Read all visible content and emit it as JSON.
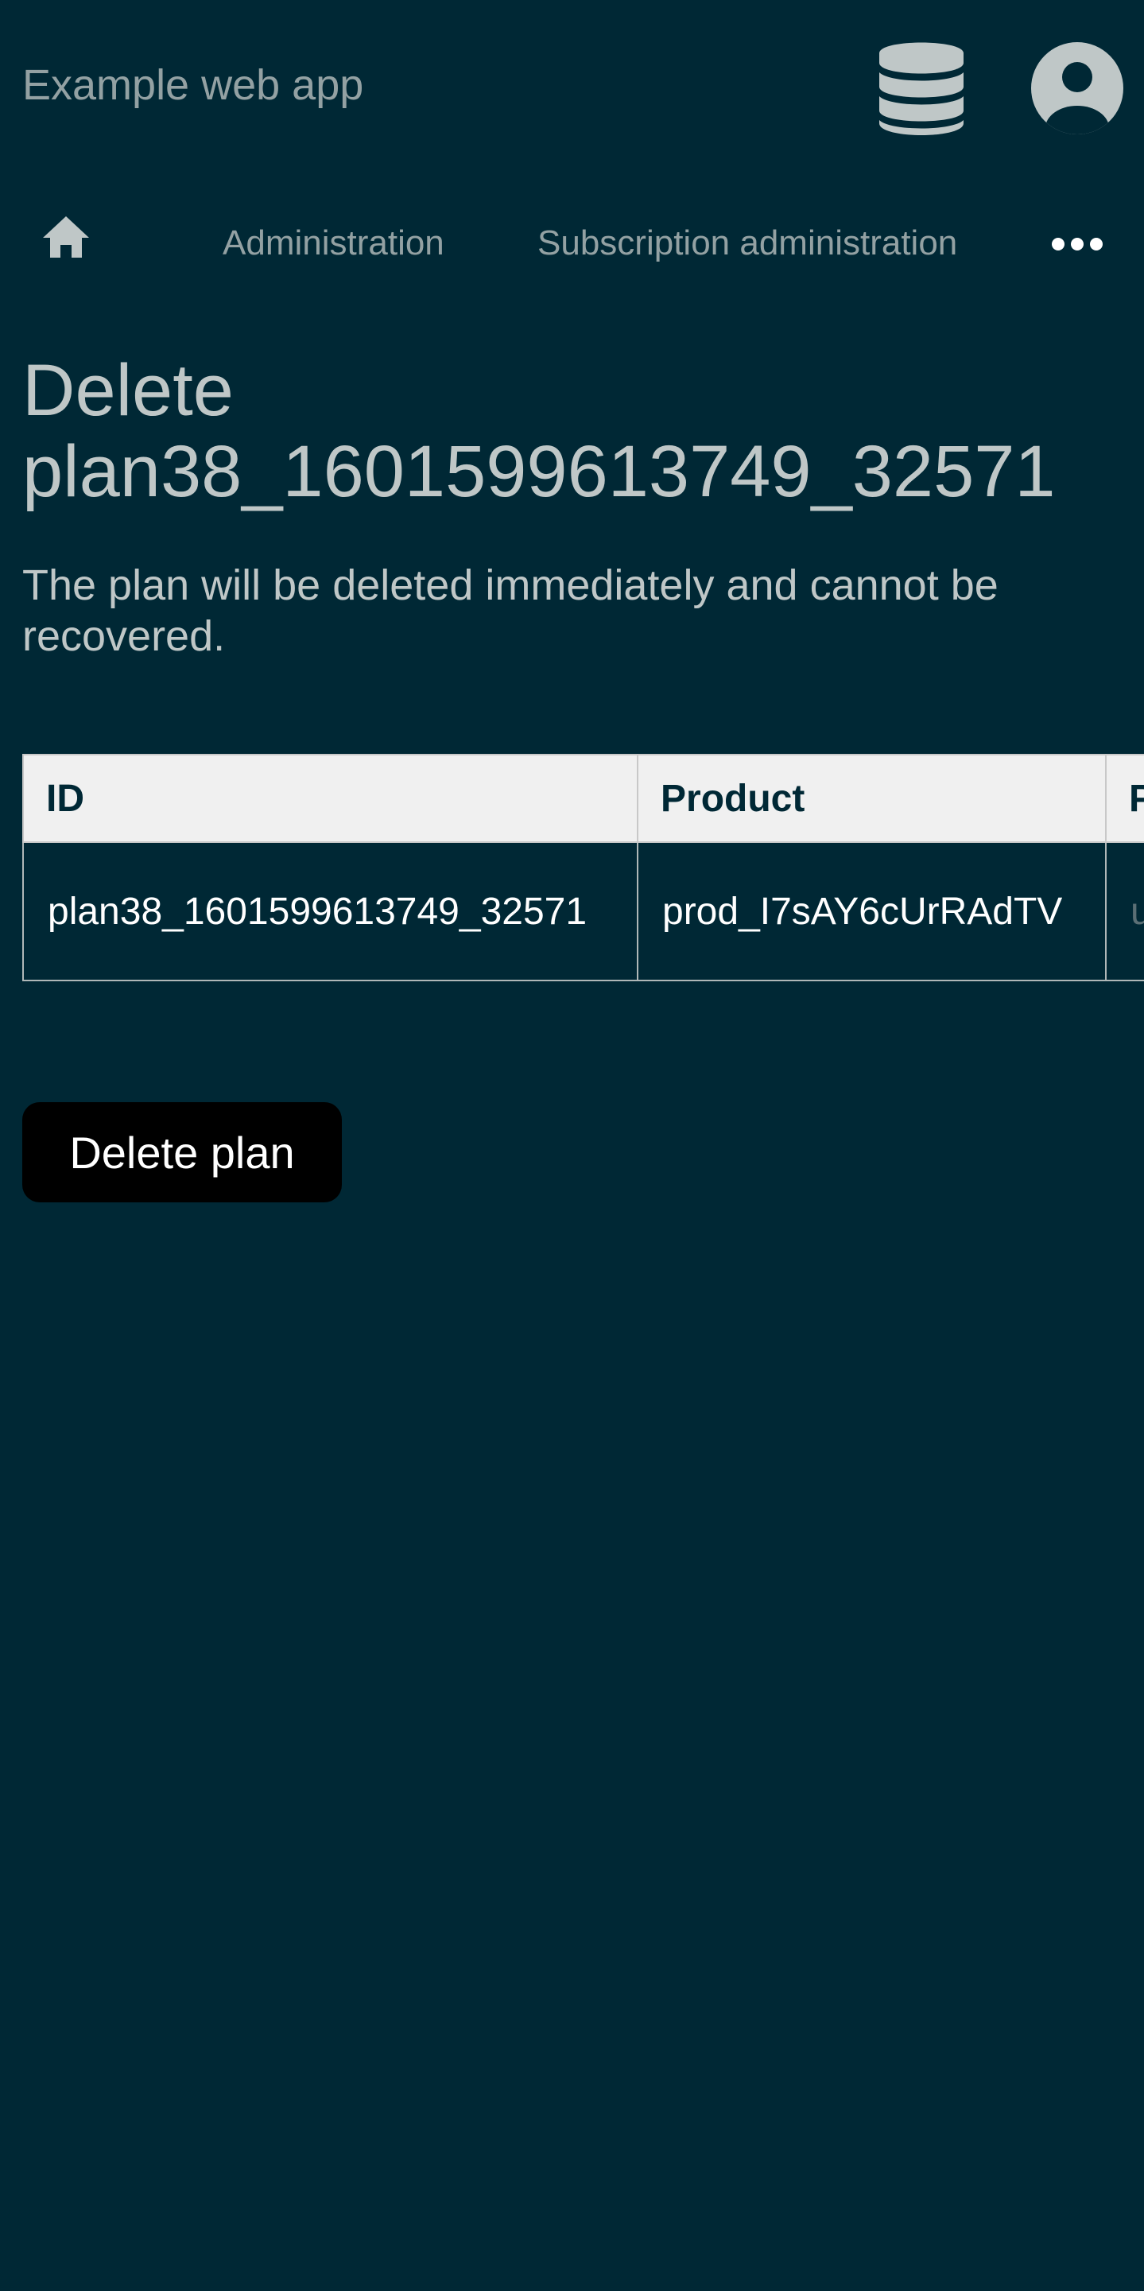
{
  "header": {
    "app_title": "Example web app",
    "icons": [
      "database-icon",
      "user-avatar-icon"
    ]
  },
  "nav": {
    "home_icon": "home-icon",
    "items": [
      {
        "label": "Administration"
      },
      {
        "label": "Subscription administration"
      }
    ],
    "more_icon": "ellipsis-icon"
  },
  "main": {
    "title": "Delete plan38_1601599613749_32571",
    "description": "The plan will be deleted immediately and cannot be recovered.",
    "table": {
      "columns": [
        "ID",
        "Product",
        "P"
      ],
      "rows": [
        [
          "plan38_1601599613749_32571",
          "prod_I7sAY6cUrRAdTV",
          "u"
        ]
      ]
    },
    "delete_button_label": "Delete plan"
  },
  "colors": {
    "background": "#002835",
    "muted_text": "#93a1a3",
    "heading_text": "#bfc7c7",
    "table_header_bg": "#f0f0f0",
    "button_bg": "#000000"
  }
}
